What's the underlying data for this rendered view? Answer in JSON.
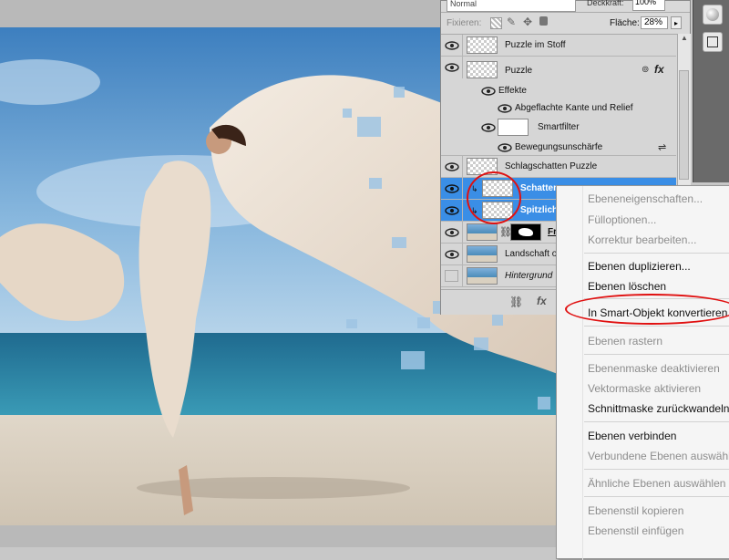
{
  "top_bar": {
    "blend_mode": "Normal",
    "opacity_label": "Deckkraft:",
    "opacity_value": "100%"
  },
  "lock_bar": {
    "lock_label": "Fixieren:",
    "fill_label": "Fläche:",
    "fill_value": "28%"
  },
  "layers": [
    {
      "name": "Puzzle im Stoff"
    },
    {
      "name": "Puzzle"
    },
    {
      "name": "Effekte"
    },
    {
      "name": "Abgeflachte Kante und Relief"
    },
    {
      "name": "Smartfilter"
    },
    {
      "name": "Bewegungsunschärfe"
    },
    {
      "name": "Schlagschatten Puzzle"
    },
    {
      "name": "Schatten"
    },
    {
      "name": "Spitzlich"
    },
    {
      "name": "Fr"
    },
    {
      "name": "Landschaft o"
    },
    {
      "name": "Hintergrund"
    }
  ],
  "context_menu": {
    "items": [
      {
        "label": "Ebeneneigenschaften...",
        "enabled": false
      },
      {
        "label": "Fülloptionen...",
        "enabled": false
      },
      {
        "label": "Korrektur bearbeiten...",
        "enabled": false
      },
      {
        "label": "Ebenen duplizieren...",
        "enabled": true
      },
      {
        "label": "Ebenen löschen",
        "enabled": true
      },
      {
        "label": "In Smart-Objekt konvertieren",
        "enabled": true,
        "highlighted": true
      },
      {
        "label": "Ebenen rastern",
        "enabled": false
      },
      {
        "label": "Ebenenmaske deaktivieren",
        "enabled": false
      },
      {
        "label": "Vektormaske aktivieren",
        "enabled": false
      },
      {
        "label": "Schnittmaske zurückwandeln",
        "enabled": true
      },
      {
        "label": "Ebenen verbinden",
        "enabled": true
      },
      {
        "label": "Verbundene Ebenen auswählen",
        "enabled": false
      },
      {
        "label": "Ähnliche Ebenen auswählen",
        "enabled": false
      },
      {
        "label": "Ebenenstil kopieren",
        "enabled": false
      },
      {
        "label": "Ebenenstil einfügen",
        "enabled": false
      }
    ]
  },
  "colors": {
    "selection": "#3a8ee6",
    "annotation": "#e01010",
    "panel": "#d6d6d6"
  }
}
